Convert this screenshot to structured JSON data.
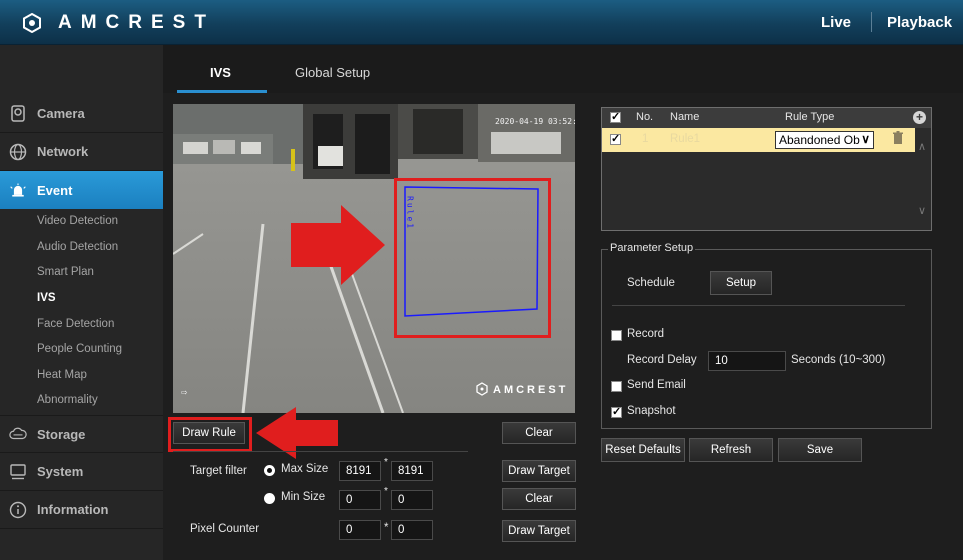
{
  "header": {
    "logo_text": "AMCREST",
    "nav": {
      "live": "Live",
      "playback": "Playback"
    }
  },
  "sidebar": {
    "items": [
      {
        "label": "Camera",
        "icon": "camera-icon"
      },
      {
        "label": "Network",
        "icon": "globe-icon"
      },
      {
        "label": "Event",
        "icon": "alarm-icon",
        "active": true
      },
      {
        "label": "Storage",
        "icon": "cloud-icon"
      },
      {
        "label": "System",
        "icon": "monitor-icon"
      },
      {
        "label": "Information",
        "icon": "info-icon"
      }
    ],
    "event_subitems": [
      "Video Detection",
      "Audio Detection",
      "Smart Plan",
      "IVS",
      "Face Detection",
      "People Counting",
      "Heat Map",
      "Abnormality"
    ],
    "current_subitem": "IVS"
  },
  "tabs": {
    "ivs": "IVS",
    "global_setup": "Global Setup"
  },
  "video": {
    "timestamp": "2020-04-19 03:52:42",
    "watermark": "AMCREST",
    "rule_label": "Rule1"
  },
  "controls": {
    "draw_rule": "Draw Rule",
    "clear": "Clear",
    "draw_target": "Draw Target",
    "target_filter_label": "Target filter",
    "max_size_label": "Max Size",
    "min_size_label": "Min Size",
    "max_w": "8191",
    "max_h": "8191",
    "min_w": "0",
    "min_h": "0",
    "pixel_counter_label": "Pixel Counter",
    "px_w": "0",
    "px_h": "0",
    "sep_star": "*"
  },
  "rules_table": {
    "headers": {
      "no": "No.",
      "name": "Name",
      "rule_type": "Rule Type"
    },
    "rows": [
      {
        "checked": true,
        "no": "1",
        "name": "Rule1",
        "rule_type": "Abandoned Ob"
      }
    ]
  },
  "parameter_setup": {
    "legend": "Parameter Setup",
    "schedule_label": "Schedule",
    "setup_button": "Setup",
    "record_label": "Record",
    "record_checked": false,
    "record_delay_label": "Record Delay",
    "record_delay_value": "10",
    "record_delay_units": "Seconds (10~300)",
    "send_email_label": "Send Email",
    "send_email_checked": false,
    "snapshot_label": "Snapshot",
    "snapshot_checked": true
  },
  "footer_buttons": {
    "reset": "Reset Defaults",
    "refresh": "Refresh",
    "save": "Save"
  },
  "colors": {
    "accent": "#1b80c0",
    "highlight": "#e01e1e",
    "selected_row": "#fbe8a1",
    "rule_line": "#1a1aff"
  }
}
